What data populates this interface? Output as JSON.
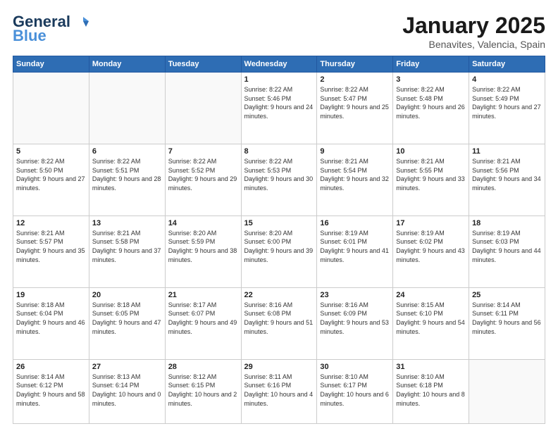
{
  "header": {
    "logo_general": "General",
    "logo_blue": "Blue",
    "month_title": "January 2025",
    "subtitle": "Benavites, Valencia, Spain"
  },
  "weekdays": [
    "Sunday",
    "Monday",
    "Tuesday",
    "Wednesday",
    "Thursday",
    "Friday",
    "Saturday"
  ],
  "weeks": [
    [
      {
        "day": "",
        "empty": true
      },
      {
        "day": "",
        "empty": true
      },
      {
        "day": "",
        "empty": true
      },
      {
        "day": "1",
        "sunrise": "Sunrise: 8:22 AM",
        "sunset": "Sunset: 5:46 PM",
        "daylight": "Daylight: 9 hours and 24 minutes."
      },
      {
        "day": "2",
        "sunrise": "Sunrise: 8:22 AM",
        "sunset": "Sunset: 5:47 PM",
        "daylight": "Daylight: 9 hours and 25 minutes."
      },
      {
        "day": "3",
        "sunrise": "Sunrise: 8:22 AM",
        "sunset": "Sunset: 5:48 PM",
        "daylight": "Daylight: 9 hours and 26 minutes."
      },
      {
        "day": "4",
        "sunrise": "Sunrise: 8:22 AM",
        "sunset": "Sunset: 5:49 PM",
        "daylight": "Daylight: 9 hours and 27 minutes."
      }
    ],
    [
      {
        "day": "5",
        "sunrise": "Sunrise: 8:22 AM",
        "sunset": "Sunset: 5:50 PM",
        "daylight": "Daylight: 9 hours and 27 minutes."
      },
      {
        "day": "6",
        "sunrise": "Sunrise: 8:22 AM",
        "sunset": "Sunset: 5:51 PM",
        "daylight": "Daylight: 9 hours and 28 minutes."
      },
      {
        "day": "7",
        "sunrise": "Sunrise: 8:22 AM",
        "sunset": "Sunset: 5:52 PM",
        "daylight": "Daylight: 9 hours and 29 minutes."
      },
      {
        "day": "8",
        "sunrise": "Sunrise: 8:22 AM",
        "sunset": "Sunset: 5:53 PM",
        "daylight": "Daylight: 9 hours and 30 minutes."
      },
      {
        "day": "9",
        "sunrise": "Sunrise: 8:21 AM",
        "sunset": "Sunset: 5:54 PM",
        "daylight": "Daylight: 9 hours and 32 minutes."
      },
      {
        "day": "10",
        "sunrise": "Sunrise: 8:21 AM",
        "sunset": "Sunset: 5:55 PM",
        "daylight": "Daylight: 9 hours and 33 minutes."
      },
      {
        "day": "11",
        "sunrise": "Sunrise: 8:21 AM",
        "sunset": "Sunset: 5:56 PM",
        "daylight": "Daylight: 9 hours and 34 minutes."
      }
    ],
    [
      {
        "day": "12",
        "sunrise": "Sunrise: 8:21 AM",
        "sunset": "Sunset: 5:57 PM",
        "daylight": "Daylight: 9 hours and 35 minutes."
      },
      {
        "day": "13",
        "sunrise": "Sunrise: 8:21 AM",
        "sunset": "Sunset: 5:58 PM",
        "daylight": "Daylight: 9 hours and 37 minutes."
      },
      {
        "day": "14",
        "sunrise": "Sunrise: 8:20 AM",
        "sunset": "Sunset: 5:59 PM",
        "daylight": "Daylight: 9 hours and 38 minutes."
      },
      {
        "day": "15",
        "sunrise": "Sunrise: 8:20 AM",
        "sunset": "Sunset: 6:00 PM",
        "daylight": "Daylight: 9 hours and 39 minutes."
      },
      {
        "day": "16",
        "sunrise": "Sunrise: 8:19 AM",
        "sunset": "Sunset: 6:01 PM",
        "daylight": "Daylight: 9 hours and 41 minutes."
      },
      {
        "day": "17",
        "sunrise": "Sunrise: 8:19 AM",
        "sunset": "Sunset: 6:02 PM",
        "daylight": "Daylight: 9 hours and 43 minutes."
      },
      {
        "day": "18",
        "sunrise": "Sunrise: 8:19 AM",
        "sunset": "Sunset: 6:03 PM",
        "daylight": "Daylight: 9 hours and 44 minutes."
      }
    ],
    [
      {
        "day": "19",
        "sunrise": "Sunrise: 8:18 AM",
        "sunset": "Sunset: 6:04 PM",
        "daylight": "Daylight: 9 hours and 46 minutes."
      },
      {
        "day": "20",
        "sunrise": "Sunrise: 8:18 AM",
        "sunset": "Sunset: 6:05 PM",
        "daylight": "Daylight: 9 hours and 47 minutes."
      },
      {
        "day": "21",
        "sunrise": "Sunrise: 8:17 AM",
        "sunset": "Sunset: 6:07 PM",
        "daylight": "Daylight: 9 hours and 49 minutes."
      },
      {
        "day": "22",
        "sunrise": "Sunrise: 8:16 AM",
        "sunset": "Sunset: 6:08 PM",
        "daylight": "Daylight: 9 hours and 51 minutes."
      },
      {
        "day": "23",
        "sunrise": "Sunrise: 8:16 AM",
        "sunset": "Sunset: 6:09 PM",
        "daylight": "Daylight: 9 hours and 53 minutes."
      },
      {
        "day": "24",
        "sunrise": "Sunrise: 8:15 AM",
        "sunset": "Sunset: 6:10 PM",
        "daylight": "Daylight: 9 hours and 54 minutes."
      },
      {
        "day": "25",
        "sunrise": "Sunrise: 8:14 AM",
        "sunset": "Sunset: 6:11 PM",
        "daylight": "Daylight: 9 hours and 56 minutes."
      }
    ],
    [
      {
        "day": "26",
        "sunrise": "Sunrise: 8:14 AM",
        "sunset": "Sunset: 6:12 PM",
        "daylight": "Daylight: 9 hours and 58 minutes."
      },
      {
        "day": "27",
        "sunrise": "Sunrise: 8:13 AM",
        "sunset": "Sunset: 6:14 PM",
        "daylight": "Daylight: 10 hours and 0 minutes."
      },
      {
        "day": "28",
        "sunrise": "Sunrise: 8:12 AM",
        "sunset": "Sunset: 6:15 PM",
        "daylight": "Daylight: 10 hours and 2 minutes."
      },
      {
        "day": "29",
        "sunrise": "Sunrise: 8:11 AM",
        "sunset": "Sunset: 6:16 PM",
        "daylight": "Daylight: 10 hours and 4 minutes."
      },
      {
        "day": "30",
        "sunrise": "Sunrise: 8:10 AM",
        "sunset": "Sunset: 6:17 PM",
        "daylight": "Daylight: 10 hours and 6 minutes."
      },
      {
        "day": "31",
        "sunrise": "Sunrise: 8:10 AM",
        "sunset": "Sunset: 6:18 PM",
        "daylight": "Daylight: 10 hours and 8 minutes."
      },
      {
        "day": "",
        "empty": true
      }
    ]
  ]
}
